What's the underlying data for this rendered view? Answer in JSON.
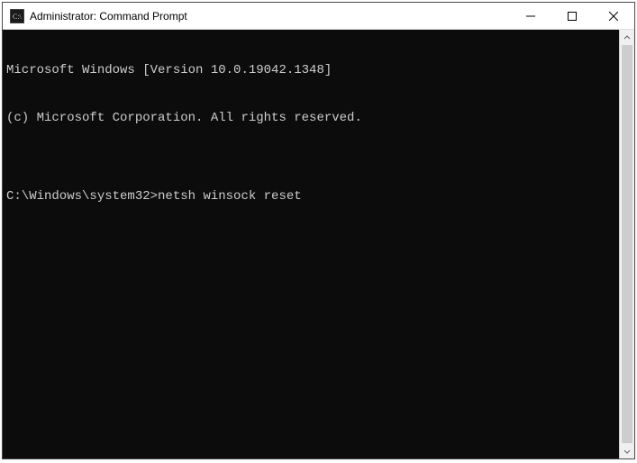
{
  "window": {
    "title": "Administrator: Command Prompt"
  },
  "terminal": {
    "lines": [
      "Microsoft Windows [Version 10.0.19042.1348]",
      "(c) Microsoft Corporation. All rights reserved.",
      "",
      ""
    ],
    "prompt": "C:\\Windows\\system32>",
    "command": "netsh winsock reset"
  }
}
